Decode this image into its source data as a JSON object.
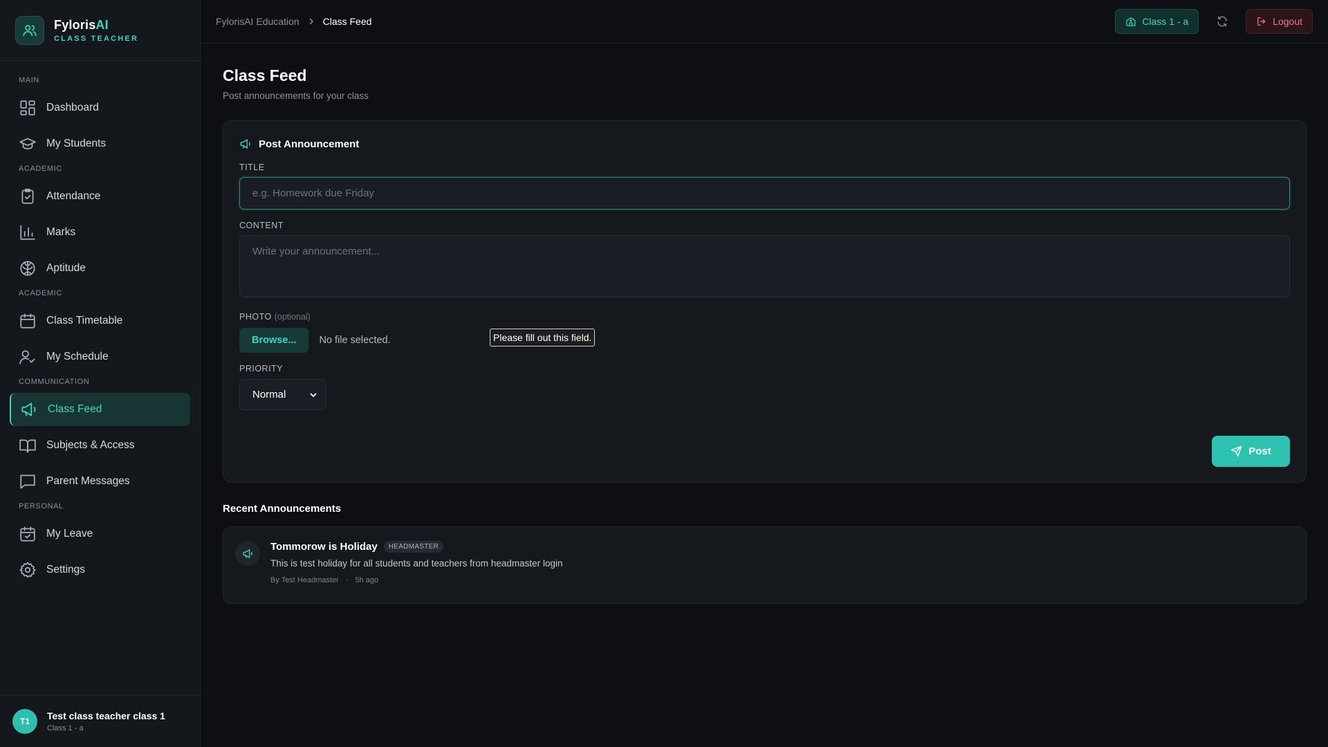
{
  "brand": {
    "name_main": "Fyloris",
    "name_accent": "AI",
    "role": "CLASS TEACHER"
  },
  "sidebar": {
    "sections": [
      {
        "label": "MAIN",
        "items": [
          {
            "label": "Dashboard",
            "icon": "dashboard-icon"
          },
          {
            "label": "My Students",
            "icon": "graduation-cap-icon"
          }
        ]
      },
      {
        "label": "ACADEMIC",
        "items": [
          {
            "label": "Attendance",
            "icon": "clipboard-check-icon"
          },
          {
            "label": "Marks",
            "icon": "bar-chart-icon"
          },
          {
            "label": "Aptitude",
            "icon": "brain-icon"
          }
        ]
      },
      {
        "label": "ACADEMIC",
        "items": [
          {
            "label": "Class Timetable",
            "icon": "calendar-icon"
          },
          {
            "label": "My Schedule",
            "icon": "user-check-icon"
          }
        ]
      },
      {
        "label": "COMMUNICATION",
        "items": [
          {
            "label": "Class Feed",
            "icon": "megaphone-icon",
            "active": true
          },
          {
            "label": "Subjects & Access",
            "icon": "book-icon"
          },
          {
            "label": "Parent Messages",
            "icon": "message-icon"
          }
        ]
      },
      {
        "label": "PERSONAL",
        "items": [
          {
            "label": "My Leave",
            "icon": "calendar-check-icon"
          },
          {
            "label": "Settings",
            "icon": "gear-icon"
          }
        ]
      }
    ]
  },
  "user": {
    "initials": "T1",
    "name": "Test class teacher class 1",
    "class": "Class 1 - a"
  },
  "topbar": {
    "breadcrumb_root": "FylorisAI Education",
    "breadcrumb_current": "Class Feed",
    "class_label": "Class 1 - a",
    "logout_label": "Logout"
  },
  "page": {
    "title": "Class Feed",
    "subtitle": "Post announcements for your class"
  },
  "form": {
    "heading": "Post Announcement",
    "title_label": "TITLE",
    "title_placeholder": "e.g. Homework due Friday",
    "title_value": "",
    "content_label": "CONTENT",
    "content_placeholder": "Write your announcement...",
    "photo_label": "PHOTO",
    "photo_optional": "(optional)",
    "browse_label": "Browse...",
    "file_status": "No file selected.",
    "validation_tooltip": "Please fill out this field.",
    "priority_label": "PRIORITY",
    "priority_value": "Normal",
    "post_label": "Post"
  },
  "recent": {
    "heading": "Recent Announcements",
    "items": [
      {
        "title": "Tommorow is Holiday",
        "badge": "HEADMASTER",
        "text": "This is test holiday for all students and teachers from headmaster login",
        "author": "By Test Headmaster",
        "separator": "·",
        "time": "5h ago"
      }
    ]
  },
  "colors": {
    "accent": "#3fd5c2",
    "background": "#0d0f12",
    "panel": "#15181d",
    "danger": "#f07a85"
  }
}
